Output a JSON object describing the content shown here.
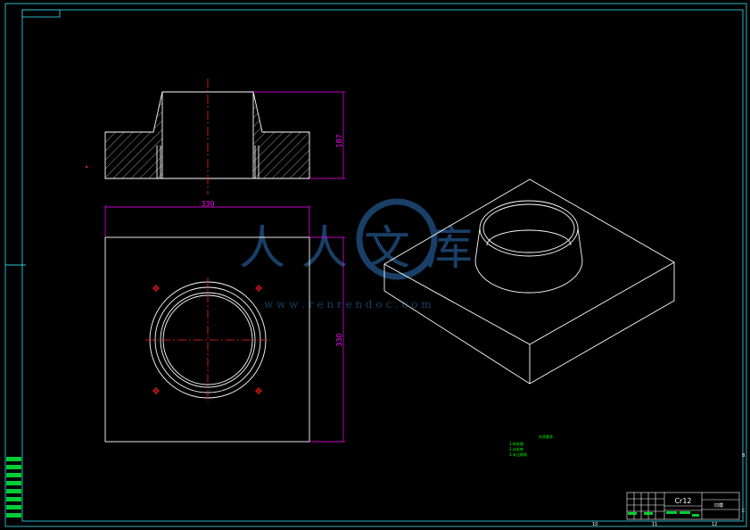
{
  "colors": {
    "background": "#000000",
    "frame": "#2fc6d6",
    "geometry": "#ffffff",
    "centerline": "#ff2020",
    "dimension": "#ff00ff",
    "notes": "#00ff00",
    "watermark": "#1e4a7a"
  },
  "dimensions": {
    "height": "187",
    "width": "330",
    "depth": "330"
  },
  "title_block": {
    "material": "Cr12",
    "drawing_name": "凹模"
  },
  "notes": {
    "heading": "技术要求",
    "lines": [
      "1.热处理",
      "2.去毛刺",
      "3.未注倒角"
    ]
  },
  "border_zones": {
    "bottom": [
      "10",
      "11",
      "12"
    ],
    "right": [
      "B",
      "C"
    ]
  },
  "watermark": {
    "brand_cn": "人人文库",
    "url": "w w w . r e n r e n d o c . c o m"
  }
}
